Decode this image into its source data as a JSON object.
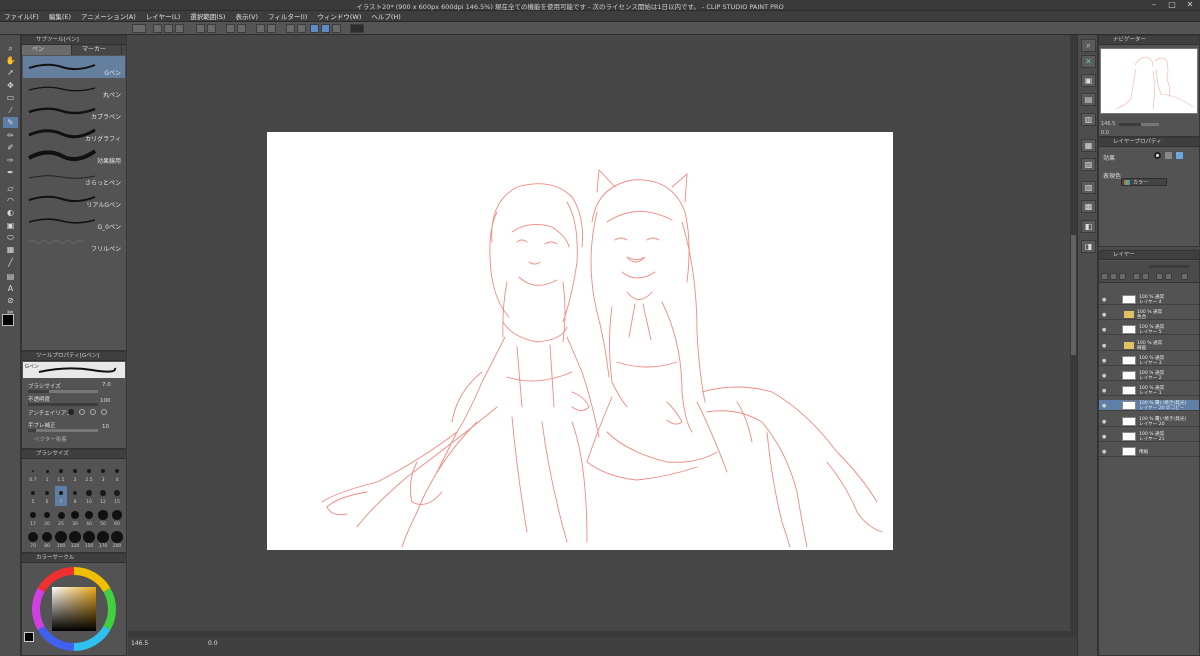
{
  "window": {
    "title": "イラスト20* (900 x 600px 600dpi 146.5%) 現在全ての機能を使用可能です - 次のライセンス開始は1日以内です。 - CLIP STUDIO PAINT PRO",
    "minimize": "–",
    "maximize": "□",
    "close": "✕"
  },
  "menu": [
    "ファイル(F)",
    "編集(E)",
    "アニメーション(A)",
    "レイヤー(L)",
    "選択範囲(S)",
    "表示(V)",
    "フィルター(I)",
    "ウィンドウ(W)",
    "ヘルプ(H)"
  ],
  "subtool": {
    "title": "サブツール[ペン]",
    "tabs": [
      "ペン",
      "マーカー"
    ],
    "brushes": [
      "Gペン",
      "丸ペン",
      "カブラペン",
      "カリグラフィ",
      "効果線用",
      "さらっとペン",
      "リアルGペン",
      "G_0ペン",
      "フリルペン"
    ],
    "selected_index": 0
  },
  "tool_property": {
    "title": "ツールプロパティ[Gペン]",
    "preview_name": "Gペン",
    "brush_size_label": "ブラシサイズ",
    "brush_size_value": "7.0",
    "opacity_label": "不透明度",
    "opacity_value": "100",
    "antialias_label": "アンチエイリアス",
    "stabilize_label": "手ブレ補正",
    "stabilize_value": "10",
    "vector_label": "ベクター吸着"
  },
  "brush_size_panel": {
    "title": "ブラシサイズ",
    "sizes": [
      "0.7",
      "1",
      "1.5",
      "2",
      "2.5",
      "3",
      "4",
      "5",
      "6",
      "7",
      "8",
      "10",
      "12",
      "15",
      "17",
      "20",
      "25",
      "30",
      "40",
      "50",
      "60",
      "70",
      "80",
      "100",
      "120",
      "150",
      "170",
      "200"
    ],
    "selected": "7"
  },
  "color_panel": {
    "title": "カラーサークル"
  },
  "status": {
    "zoom": "146.5",
    "angle": "0.0"
  },
  "navigator": {
    "title": "ナビゲーター",
    "zoom": "146.5",
    "angle": "0.0"
  },
  "layer_property": {
    "title": "レイヤープロパティ",
    "effect_label": "効果",
    "expression_label": "表現色",
    "expression_value": "カラー"
  },
  "layers": {
    "title": "レイヤー",
    "rows": [
      {
        "mode": "100 % 通常",
        "name": "レイヤー 4",
        "type": "layer",
        "selected": false
      },
      {
        "mode": "100 % 通常",
        "name": "色合",
        "type": "folder",
        "selected": false
      },
      {
        "mode": "100 % 通常",
        "name": "レイヤー 5",
        "type": "layer",
        "selected": false
      },
      {
        "mode": "100 % 通常",
        "name": "線画",
        "type": "folder",
        "selected": false
      },
      {
        "mode": "100 % 通常",
        "name": "レイヤー 3",
        "type": "layer",
        "selected": false
      },
      {
        "mode": "100 % 通常",
        "name": "レイヤー 2",
        "type": "layer",
        "selected": false
      },
      {
        "mode": "100 % 通常",
        "name": "レイヤー 1",
        "type": "layer",
        "selected": false
      },
      {
        "mode": "100 % 覆い焼き(発光)",
        "name": "レイヤー 20 のコピー",
        "type": "layer",
        "selected": true
      },
      {
        "mode": "100 % 覆い焼き(発光)",
        "name": "レイヤー 20",
        "type": "layer",
        "selected": false
      },
      {
        "mode": "100 % 通常",
        "name": "レイヤー 21",
        "type": "layer",
        "selected": false
      },
      {
        "mode": "",
        "name": "用紙",
        "type": "paper",
        "selected": false
      }
    ]
  },
  "colors": {
    "accent": "#5f7fa6",
    "sketch": "#f08a80",
    "canvas_bg": "#474747"
  }
}
